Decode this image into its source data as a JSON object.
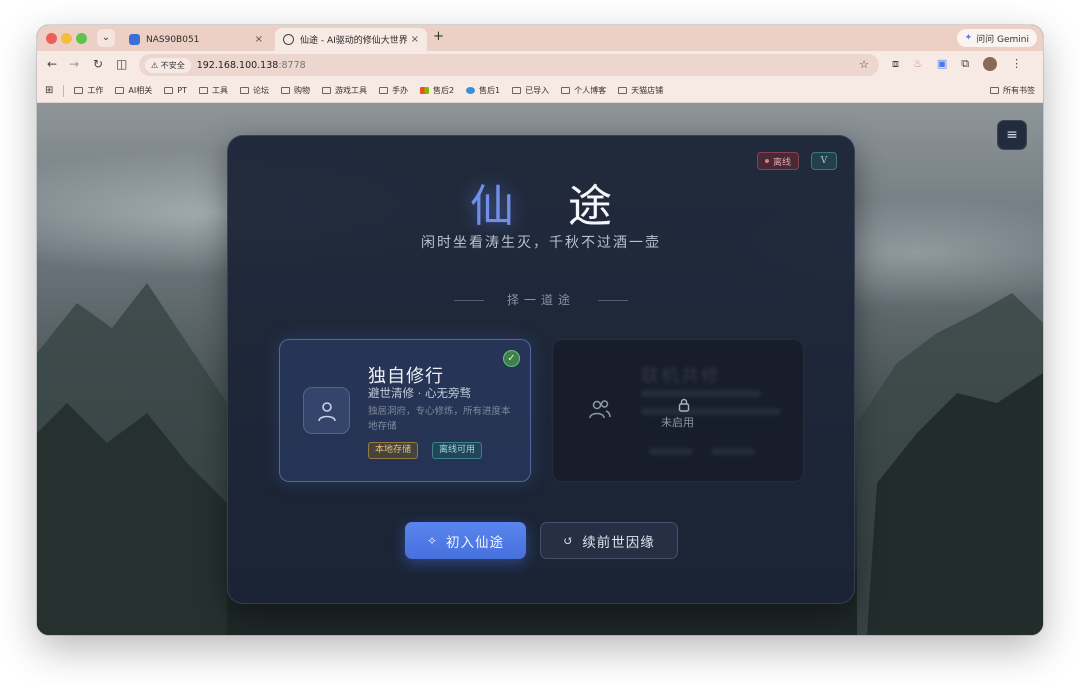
{
  "browser": {
    "tabs": [
      {
        "label": "NAS90B051",
        "close": "×"
      },
      {
        "label": "仙途 - AI驱动的修仙大世界 | AI",
        "close": "×"
      }
    ],
    "new_tab": "+",
    "gemini_label": "问问 Gemini",
    "security_label": "不安全",
    "url_host": "192.168.100.138",
    "url_port": ":8778",
    "bookmarks": [
      "工作",
      "AI相关",
      "PT",
      "工具",
      "论坛",
      "购物",
      "游戏工具",
      "手办",
      "售后2",
      "售后1",
      "已导入",
      "个人博客",
      "天猫店铺"
    ],
    "all_bookmarks": "所有书签"
  },
  "app": {
    "status_badge": "离线",
    "version_badge": "V",
    "title_char_1": "仙",
    "title_char_2": "途",
    "subtitle": "闲时坐看涛生灭，千秋不过酒一壶",
    "choose_path": "择一道途",
    "solo_card": {
      "title": "独自修行",
      "subtitle": "避世清修 · 心无旁骛",
      "description": "独居洞府，专心修炼，所有进度本地存储",
      "tags": [
        "本地存储",
        "离线可用"
      ]
    },
    "coop_card": {
      "title": "联机共修",
      "status": "未启用"
    },
    "primary_button": "初入仙途",
    "secondary_button": "续前世因缘"
  },
  "colors": {
    "accent": "#5b85ee",
    "panel": "#1b2436",
    "tag_local": "#e3c07a",
    "tag_offline": "#9ad9dc",
    "status_offline": "#e07a80"
  },
  "icons": {
    "solo": "user-icon",
    "coop": "users-icon",
    "lock": "lock-icon",
    "start": "sparkles-icon",
    "continue": "history-icon",
    "menu": "menu-icon"
  }
}
